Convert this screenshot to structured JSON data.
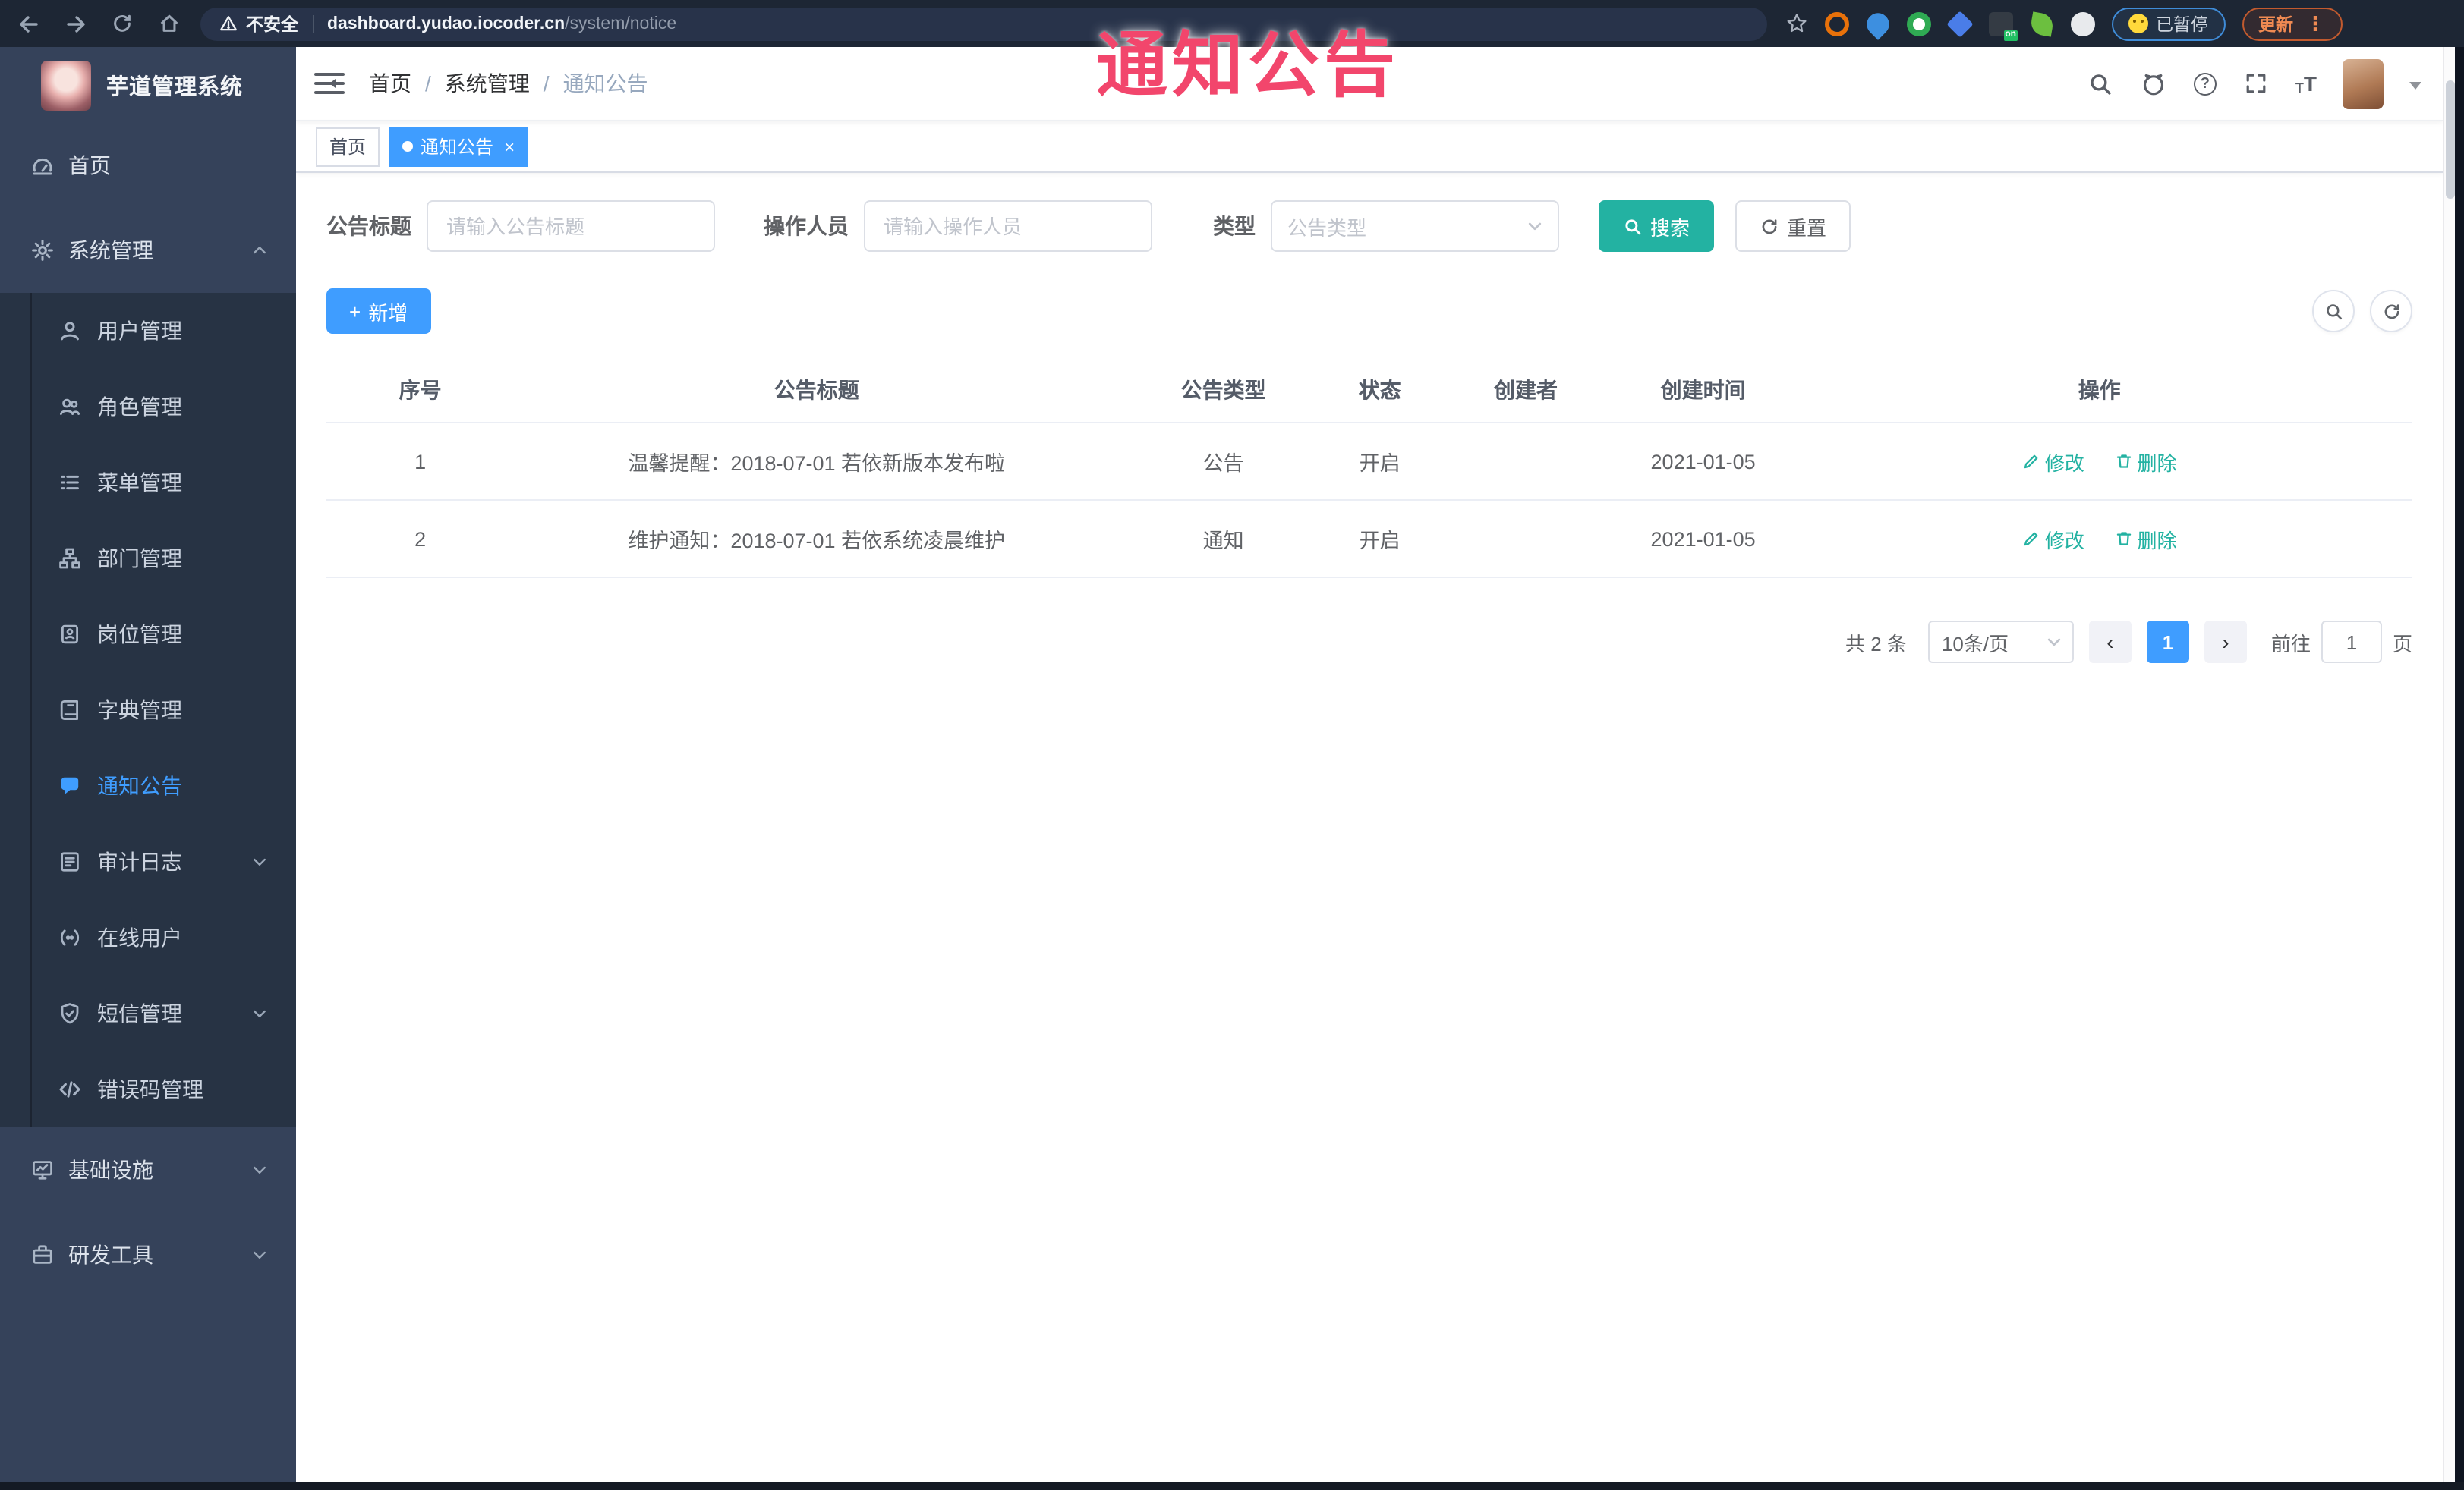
{
  "overlay": {
    "title": "通知公告",
    "color": "#f2466c"
  },
  "browser": {
    "security_label": "不安全",
    "url_host": "dashboard.yudao.iocoder.cn",
    "url_path": "/system/notice",
    "paused_label": "已暂停",
    "update_label": "更新"
  },
  "glyphs": {
    "slash": "/",
    "close": "×",
    "plus": "+",
    "prev": "‹",
    "next": "›",
    "kebab": "⋮",
    "question": "?",
    "t_small": "T",
    "t_big": "T",
    "on_badge": "on"
  },
  "app": {
    "title": "芋道管理系统"
  },
  "sidebar": {
    "items": [
      {
        "label": "首页"
      },
      {
        "label": "系统管理"
      }
    ],
    "submenu": [
      {
        "label": "用户管理"
      },
      {
        "label": "角色管理"
      },
      {
        "label": "菜单管理"
      },
      {
        "label": "部门管理"
      },
      {
        "label": "岗位管理"
      },
      {
        "label": "字典管理"
      },
      {
        "label": "通知公告"
      },
      {
        "label": "审计日志"
      },
      {
        "label": "在线用户"
      },
      {
        "label": "短信管理"
      },
      {
        "label": "错误码管理"
      }
    ],
    "bottom_items": [
      {
        "label": "基础设施"
      },
      {
        "label": "研发工具"
      }
    ]
  },
  "breadcrumb": {
    "items": [
      {
        "label": "首页"
      },
      {
        "label": "系统管理"
      },
      {
        "label": "通知公告"
      }
    ]
  },
  "tabs": {
    "items": [
      {
        "label": "首页"
      },
      {
        "label": "通知公告"
      }
    ]
  },
  "filters": {
    "title_label": "公告标题",
    "title_placeholder": "请输入公告标题",
    "operator_label": "操作人员",
    "operator_placeholder": "请输入操作人员",
    "type_label": "类型",
    "type_placeholder": "公告类型",
    "search_label": "搜索",
    "reset_label": "重置"
  },
  "toolbar": {
    "add_label": "新增"
  },
  "table": {
    "headers": [
      "序号",
      "公告标题",
      "公告类型",
      "状态",
      "创建者",
      "创建时间",
      "操作"
    ],
    "rows": [
      {
        "no": "1",
        "title": "温馨提醒：2018-07-01 若依新版本发布啦",
        "type": "公告",
        "status": "开启",
        "creator": "",
        "time": "2021-01-05"
      },
      {
        "no": "2",
        "title": "维护通知：2018-07-01 若依系统凌晨维护",
        "type": "通知",
        "status": "开启",
        "creator": "",
        "time": "2021-01-05"
      }
    ],
    "edit_label": "修改",
    "delete_label": "删除"
  },
  "pagination": {
    "total": "共 2 条",
    "page_size": "10条/页",
    "page": "1",
    "goto_label": "前往",
    "goto_value": "1",
    "unit_label": "页"
  },
  "colors": {
    "primary": "#3f9dff",
    "teal": "#23b2a2",
    "annotation_pink": "#f2466c"
  }
}
